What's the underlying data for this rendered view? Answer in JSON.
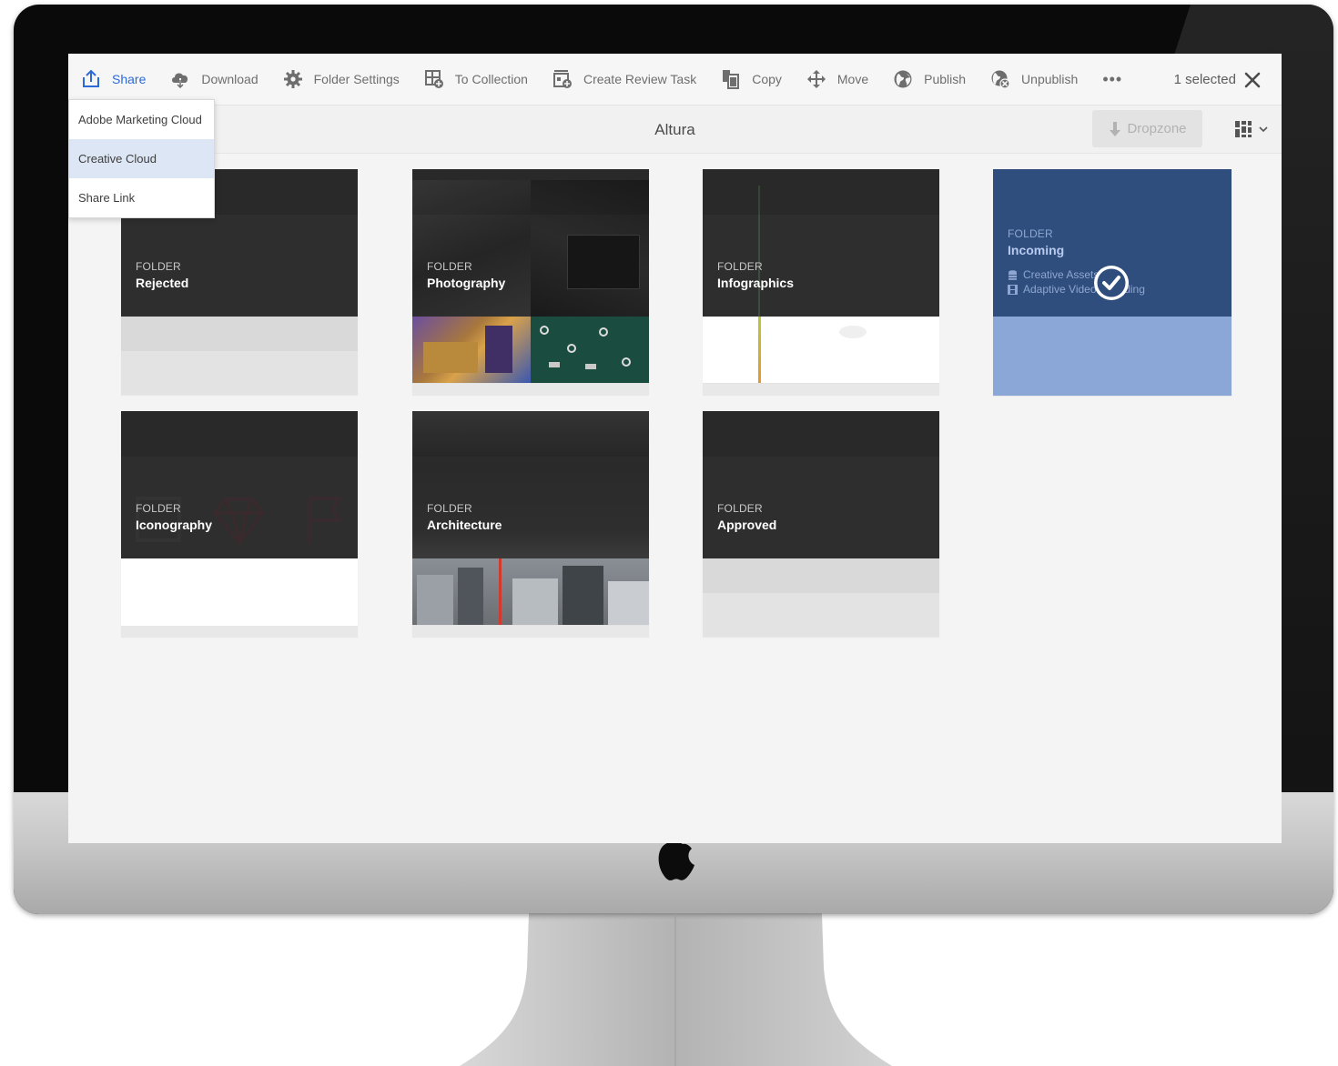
{
  "toolbar": {
    "actions": [
      {
        "label": "Share",
        "icon": "share-icon",
        "active": true
      },
      {
        "label": "Download",
        "icon": "download-icon"
      },
      {
        "label": "Folder Settings",
        "icon": "gear-icon"
      },
      {
        "label": "To Collection",
        "icon": "collection-add-icon"
      },
      {
        "label": "Create Review Task",
        "icon": "review-task-icon"
      },
      {
        "label": "Copy",
        "icon": "copy-icon"
      },
      {
        "label": "Move",
        "icon": "move-icon"
      },
      {
        "label": "Publish",
        "icon": "globe-icon"
      },
      {
        "label": "Unpublish",
        "icon": "globe-unpublish-icon"
      }
    ],
    "more_label": "•••",
    "selection_count": "1 selected"
  },
  "header": {
    "title": "Altura",
    "dropzone_label": "Dropzone"
  },
  "share_menu": {
    "items": [
      "Adobe Marketing Cloud",
      "Creative Cloud",
      "Share Link"
    ],
    "highlighted_index": 1
  },
  "folders": [
    {
      "kind": "FOLDER",
      "name": "Rejected"
    },
    {
      "kind": "FOLDER",
      "name": "Photography"
    },
    {
      "kind": "FOLDER",
      "name": "Infographics"
    },
    {
      "kind": "FOLDER",
      "name": "Incoming",
      "selected": true,
      "details": [
        "Creative Assets",
        "Adaptive Video Encoding"
      ]
    },
    {
      "kind": "FOLDER",
      "name": "Iconography"
    },
    {
      "kind": "FOLDER",
      "name": "Architecture"
    },
    {
      "kind": "FOLDER",
      "name": "Approved"
    }
  ],
  "colors": {
    "accent": "#2d6ad6",
    "selected_card": "#2f4e7d",
    "selected_card_lower": "#8aa7d8"
  }
}
